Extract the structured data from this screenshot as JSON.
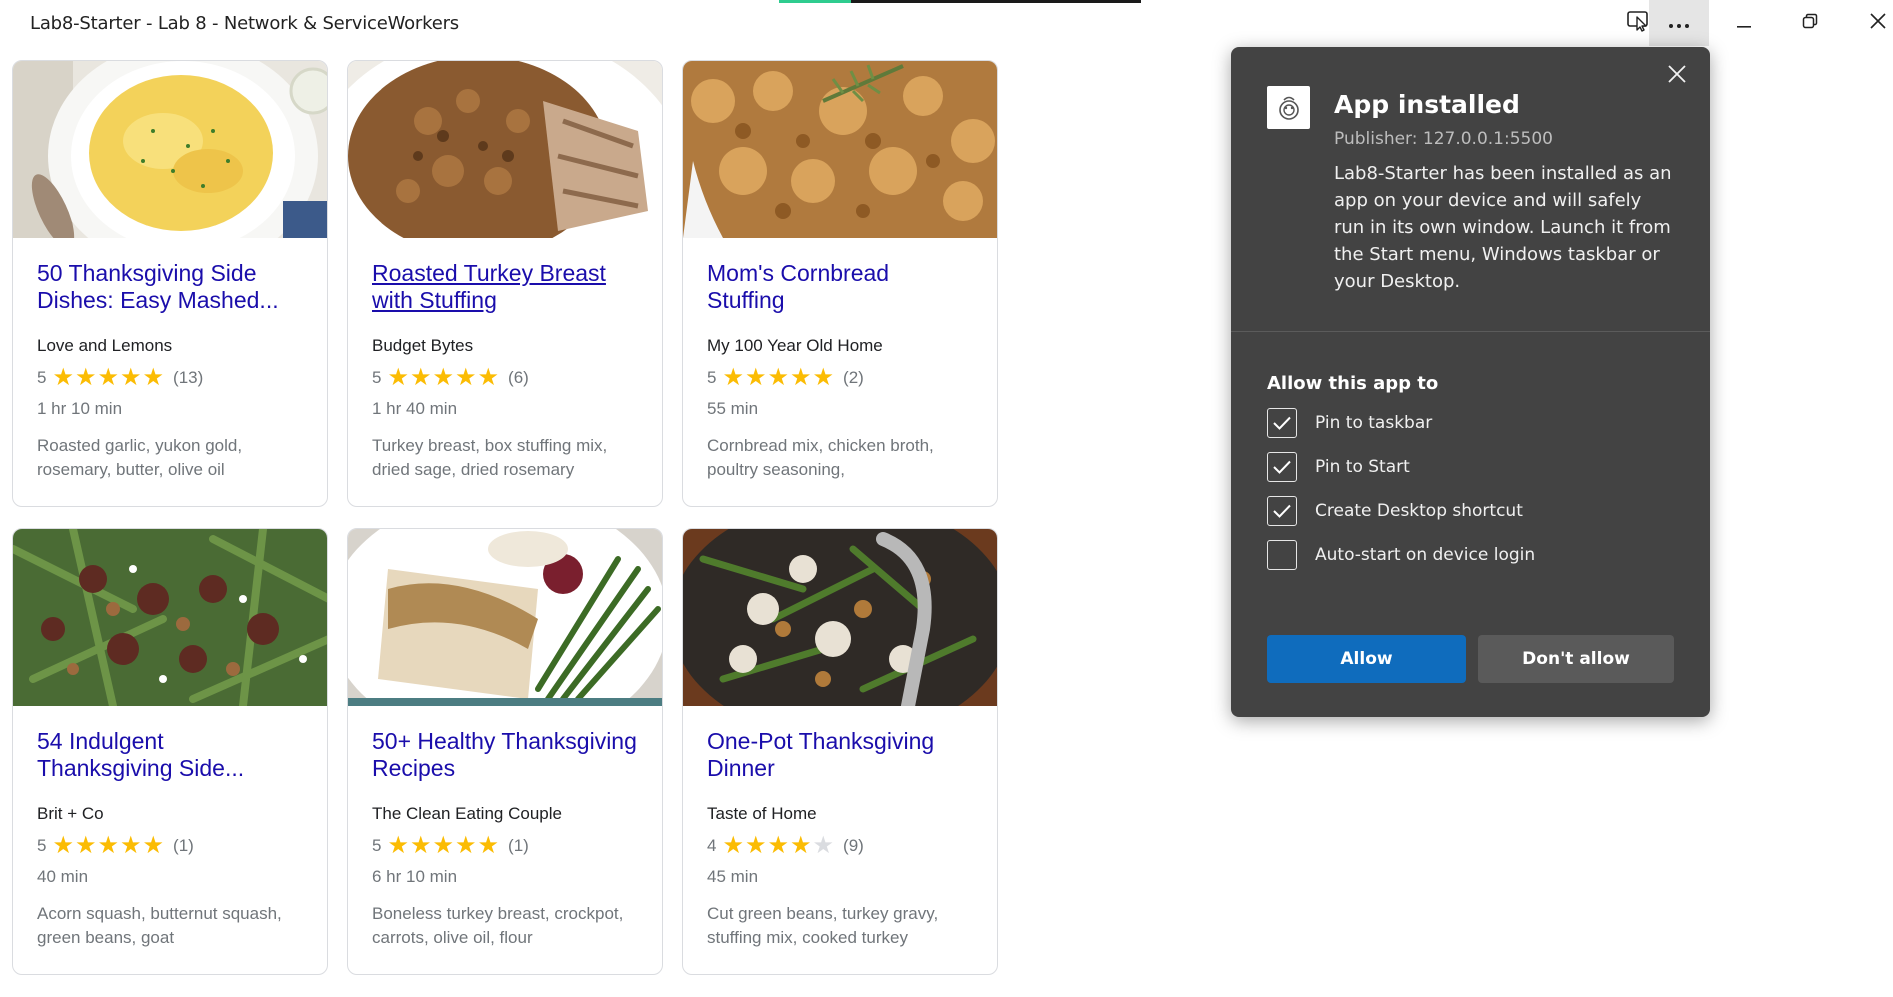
{
  "window": {
    "title": "Lab8-Starter - Lab 8 - Network & ServiceWorkers",
    "loading_progress": 0.2,
    "icons": {
      "cast": "cast-icon",
      "more": "more-icon",
      "minimize": "minimize-icon",
      "restore": "restore-icon",
      "close": "close-icon"
    }
  },
  "recipes": [
    {
      "title": "50 Thanksgiving Side Dishes: Easy Mashed...",
      "visited": false,
      "org": "Love and Lemons",
      "rating": "5",
      "stars": 5,
      "reviews": "(13)",
      "time": "1 hr 10 min",
      "ingredients": "Roasted garlic, yukon gold, rosemary, butter, olive oil",
      "image": "mashed-potatoes"
    },
    {
      "title": "Roasted Turkey Breast with Stuffing",
      "visited": true,
      "org": "Budget Bytes",
      "rating": "5",
      "stars": 5,
      "reviews": "(6)",
      "time": "1 hr 40 min",
      "ingredients": "Turkey breast, box stuffing mix, dried sage, dried rosemary",
      "image": "turkey-stuffing"
    },
    {
      "title": "Mom's Cornbread Stuffing",
      "visited": false,
      "org": "My 100 Year Old Home",
      "rating": "5",
      "stars": 5,
      "reviews": "(2)",
      "time": "55 min",
      "ingredients": "Cornbread mix, chicken broth, poultry seasoning,",
      "image": "cornbread-stuffing"
    },
    {
      "title": "54 Indulgent Thanksgiving Side...",
      "visited": false,
      "org": "Brit + Co",
      "rating": "5",
      "stars": 5,
      "reviews": "(1)",
      "time": "40 min",
      "ingredients": "Acorn squash, butternut squash, green beans, goat",
      "image": "green-beans-pecans"
    },
    {
      "title": "50+ Healthy Thanksgiving Recipes",
      "visited": false,
      "org": "The Clean Eating Couple",
      "rating": "5",
      "stars": 5,
      "reviews": "(1)",
      "time": "6 hr 10 min",
      "ingredients": "Boneless turkey breast, crockpot, carrots, olive oil, flour",
      "image": "turkey-gravy-plate"
    },
    {
      "title": "One-Pot Thanksgiving Dinner",
      "visited": false,
      "org": "Taste of Home",
      "rating": "4",
      "stars": 4,
      "reviews": "(9)",
      "time": "45 min",
      "ingredients": "Cut green beans, turkey gravy, stuffing mix, cooked turkey",
      "image": "one-pot-dinner"
    }
  ],
  "popup": {
    "title": "App installed",
    "publisher": "Publisher: 127.0.0.1:5500",
    "description": "Lab8-Starter has been installed as an app on your device and will safely run in its own window. Launch it from the Start menu, Windows taskbar or your Desktop.",
    "allow_heading": "Allow this app to",
    "options": [
      {
        "label": "Pin to taskbar",
        "checked": true
      },
      {
        "label": "Pin to Start",
        "checked": true
      },
      {
        "label": "Create Desktop shortcut",
        "checked": true
      },
      {
        "label": "Auto-start on device login",
        "checked": false
      }
    ],
    "allow_label": "Allow",
    "deny_label": "Don't allow"
  },
  "colors": {
    "link": "#1a0dab",
    "star": "#fbbc04",
    "popup_bg": "#434343",
    "allow_button": "#0f6cbd",
    "load_progress": "#2ecc8f"
  }
}
